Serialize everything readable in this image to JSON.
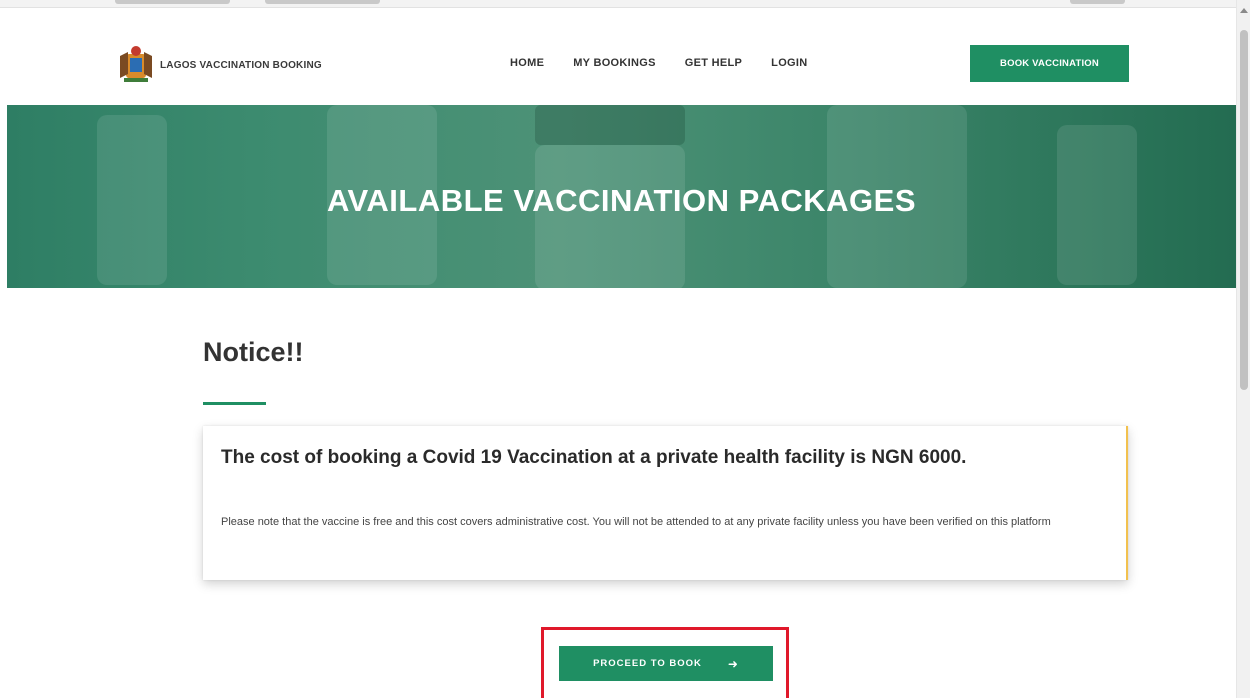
{
  "brand": {
    "name": "LAGOS VACCINATION BOOKING",
    "logo_icon": "lagos-state-crest-icon"
  },
  "nav": {
    "items": [
      {
        "label": "HOME"
      },
      {
        "label": "MY BOOKINGS"
      },
      {
        "label": "GET HELP"
      },
      {
        "label": "LOGIN"
      }
    ],
    "cta_label": "BOOK VACCINATION"
  },
  "hero": {
    "title": "AVAILABLE VACCINATION PACKAGES"
  },
  "notice": {
    "heading": "Notice!!",
    "card_title": "The cost of booking a Covid 19 Vaccination at a private health facility is NGN 6000.",
    "card_body": "Please note that the vaccine is free and this cost covers administrative cost. You will not be attended to at any private facility unless you have been verified on this platform"
  },
  "proceed": {
    "label": "PROCEED TO BOOK",
    "arrow": "➜"
  },
  "colors": {
    "brand_green": "#1f8f63",
    "highlight_red": "#e0182a",
    "card_accent": "#f2c14e"
  }
}
